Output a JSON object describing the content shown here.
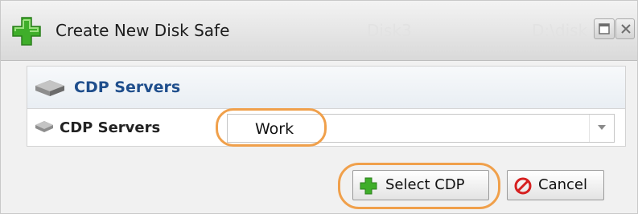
{
  "window": {
    "title": "Create New Disk Safe",
    "faded_text_1": "Disk3",
    "faded_text_2": "D:\\disk",
    "icons": [
      "add-plus-icon",
      "maximize-icon",
      "close-icon"
    ]
  },
  "panel": {
    "header_title": "CDP Servers",
    "header_icon": "server-icon",
    "row": {
      "label": "CDP Servers",
      "icon": "server-icon",
      "select_value": "Work"
    }
  },
  "buttons": {
    "select_label": "Select CDP",
    "cancel_label": "Cancel"
  },
  "colors": {
    "highlight": "#f0a04b",
    "header_text": "#1f4e8c",
    "plus_green": "#3fae2a",
    "cancel_red": "#d62020"
  }
}
